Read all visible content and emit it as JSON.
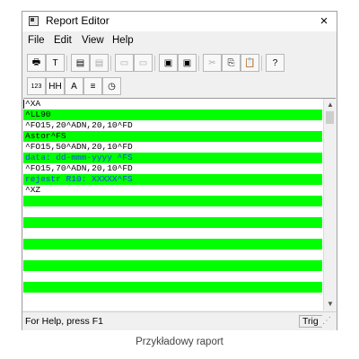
{
  "window": {
    "title": "Report Editor",
    "close_label": "×"
  },
  "menu": [
    "File",
    "Edit",
    "View",
    "Help"
  ],
  "toolbar1": [
    {
      "name": "print-icon",
      "glyph": "🖶"
    },
    {
      "name": "text-icon",
      "glyph": "T"
    },
    {
      "name": "page-icon",
      "glyph": "▤"
    },
    {
      "name": "page-disabled-icon",
      "glyph": "▤"
    },
    {
      "name": "page2-disabled-icon",
      "glyph": "▭"
    },
    {
      "name": "page3-disabled-icon",
      "glyph": "▭"
    },
    {
      "name": "template-icon",
      "glyph": "▣"
    },
    {
      "name": "template2-icon",
      "glyph": "▣"
    },
    {
      "name": "cut-icon",
      "glyph": "✂"
    },
    {
      "name": "copy-icon",
      "glyph": "⎘"
    },
    {
      "name": "paste-icon",
      "glyph": "📋"
    },
    {
      "name": "help-icon",
      "glyph": "?"
    }
  ],
  "toolbar2": [
    {
      "name": "numbers-icon",
      "glyph": "123"
    },
    {
      "name": "time-icon",
      "glyph": "HH"
    },
    {
      "name": "font-icon",
      "glyph": "A"
    },
    {
      "name": "align-icon",
      "glyph": "≡"
    },
    {
      "name": "clock-icon",
      "glyph": "◷"
    }
  ],
  "editor_lines": [
    {
      "text": "^XA",
      "color": "#000000",
      "highlight": false
    },
    {
      "text": "^LL90",
      "color": "#000000",
      "highlight": true
    },
    {
      "text": "^FO15,20^ADN,20,10^FD",
      "color": "#000000",
      "highlight": false
    },
    {
      "text": "Astor^FS",
      "color": "#000000",
      "highlight": true
    },
    {
      "text": "^FO15,50^ADN,20,10^FD",
      "color": "#000000",
      "highlight": false
    },
    {
      "text": "data: dd-mmm-yyyy ^FS",
      "color": "#1a40ff",
      "highlight": true
    },
    {
      "text": "^FO15,70^ADN,20,10^FD",
      "color": "#000000",
      "highlight": false
    },
    {
      "text": "rejestr R10: XXXXX^FS",
      "color": "#1a40ff",
      "highlight": true
    },
    {
      "text": "^XZ",
      "color": "#000000",
      "highlight": false
    },
    {
      "text": "",
      "color": "#000000",
      "highlight": true
    },
    {
      "text": "",
      "color": "#000000",
      "highlight": false
    },
    {
      "text": "",
      "color": "#000000",
      "highlight": true
    },
    {
      "text": "",
      "color": "#000000",
      "highlight": false
    },
    {
      "text": "",
      "color": "#000000",
      "highlight": true
    },
    {
      "text": "",
      "color": "#000000",
      "highlight": false
    },
    {
      "text": "",
      "color": "#000000",
      "highlight": true
    },
    {
      "text": "",
      "color": "#000000",
      "highlight": false
    },
    {
      "text": "",
      "color": "#000000",
      "highlight": true
    },
    {
      "text": "",
      "color": "#000000",
      "highlight": false
    }
  ],
  "status": {
    "text": "For Help, press F1",
    "mode": "Trig"
  },
  "caption": "Przykładowy raport"
}
